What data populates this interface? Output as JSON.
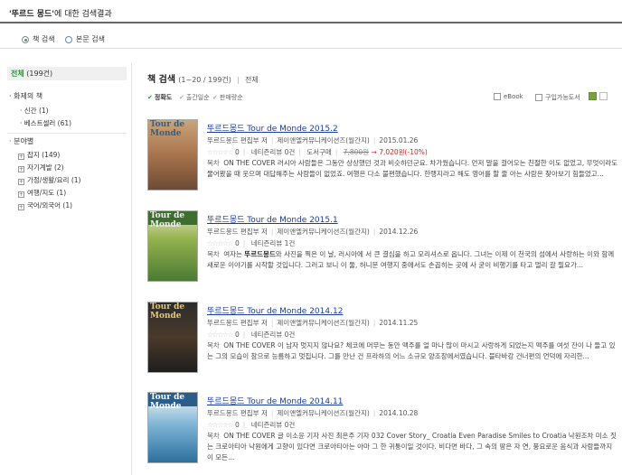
{
  "header": {
    "query": "'뚜르드 몽드'",
    "suffix": "에 대한 검색결과"
  },
  "scope": {
    "book_label": "책 검색",
    "fulltext_label": "본문 검색"
  },
  "sidebar": {
    "all_label": "전체",
    "all_count": "(199건)",
    "topic_heading": "화제의 책",
    "topic_items": [
      "신간 (1)",
      "베스트셀러 (61)"
    ],
    "category_heading": "분야별",
    "category_items": [
      "잡지 (149)",
      "자기계발 (2)",
      "가정/생활/요리 (1)",
      "여행/지도 (1)",
      "국어/외국어 (1)"
    ]
  },
  "main": {
    "heading": "책 검색",
    "count": "(1~20 / 199건)",
    "divider": "|",
    "type": "전체"
  },
  "sortbar": {
    "sort_accuracy": "정확도",
    "sort_date": "출간일순",
    "sort_sales": "판매량순",
    "ebook_label": "eBook",
    "available_label": "구입가능도서"
  },
  "results": [
    {
      "title": "뚜르드몽드 Tour de Monde 2015.2",
      "author": "뚜르드몽드 편집부 저",
      "publisher": "제이앤엘커뮤니케이션즈(월간지)",
      "date": "2015.01.26",
      "stars": "☆☆☆☆☆",
      "rating": "0",
      "reviews": "네티즌리뷰 0건",
      "buy_label": "도서구매",
      "orig_price": "7,800원",
      "arrow": "→",
      "sale_price": "7,020원(-10%)",
      "desc_label": "목차",
      "desc": "ON THE COVER 러시아 사람들은 그동안 상상했던 것과 비슷하던군요. 차가웠습니다. 먼저 말을 걸어오는 친절한 이도 없었고, 무엇이라도 물어봤을 때 웃으며 대답해주는 사람들이 없었죠. 여행은 다소 불편했습니다. 한랭지라고 해도 영어를 할 줄 아는 사람은 찾아보기 힘들었고..."
    },
    {
      "title": "뚜르드몽드 Tour de Monde 2015.1",
      "author": "뚜르드몽드 편집부 저",
      "publisher": "제이앤엘커뮤니케이션즈(월간지)",
      "date": "2014.12.26",
      "stars": "☆☆☆☆☆",
      "rating": "0",
      "reviews": "네티즌리뷰 1건",
      "desc_label": "목차",
      "desc_pre": "여자는 ",
      "desc_bold": "뚜르드몽드",
      "desc": "와 사진을 찍은 이 날, 러시아에 서 큰 결심을 하고 모리셔스로 옵니다. 그녀는 이제 이 천국의 섬에서 사랑하는 이와 함께 새로운 이야기를 시작할 것입니다. 그러고 보니 이 둘, 허니문 여행지 중에서도 손꼽히는 곳에 사 굳이 비행기를 타고 멀리 갈 필요가..."
    },
    {
      "title": "뚜르드몽드 Tour de Monde 2014.12",
      "author": "뚜르드몽드 편집부 저",
      "publisher": "제이앤엘커뮤니케이션즈(월간지)",
      "date": "2014.11.25",
      "stars": "☆☆☆☆☆",
      "rating": "0",
      "reviews": "네티즌리뷰 0건",
      "desc_label": "목차",
      "desc": "ON THE COVER 이 남자 멋지지 않나요? 체코에 머무는 동안 맥주를 얼 마나 많이 마시고 사랑하게 되었는지 맥주를 여섯 잔이 나 들고 있는 그의 모습이 참으로 능름하고 멋집니다. 그를 만난 건 프라하의 어느 소규모 양조장에서였습니다. 블타바강 건너편의 언덕에 자리한..."
    },
    {
      "title": "뚜르드몽드 Tour de Monde 2014.11",
      "author": "뚜르드몽드 편집부 저",
      "publisher": "제이앤엘커뮤니케이션즈(월간지)",
      "date": "2014.10.28",
      "stars": "☆☆☆☆☆",
      "rating": "0",
      "reviews": "네티즌리뷰 0건",
      "desc_label": "목차",
      "desc": "ON THE COVER 글 이소윤 기자 사진 최은주 기자 032 Cover Story_ Croatia Even Paradise Smiles to Croatia 낙원조차 미소 짓는 크로아티아 낙원에게 고향이 있다면 크로아티아는 아마 그 한 귀퉁이일 것이다. 비다면 바다, 그 속의 땅은 자 연, 풍요로운 음식과 사람들까지 이 모든..."
    }
  ],
  "cover_mast": "Tour de Monde",
  "colors": {
    "link": "#1a3d9a",
    "sale": "#e02020",
    "accent": "#2a9a3a"
  }
}
